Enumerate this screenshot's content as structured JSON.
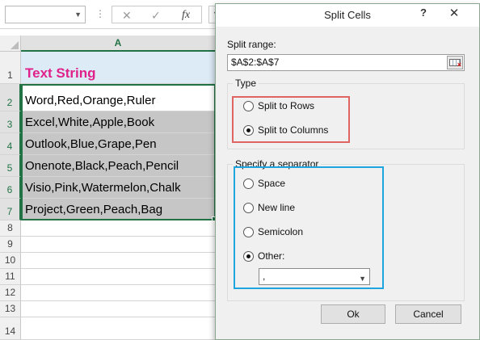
{
  "formula_bar": {
    "name_box_value": "",
    "cancel_icon": "✕",
    "enter_icon": "✓",
    "fx_label": "fx",
    "formula_value": ""
  },
  "sheet": {
    "columns": [
      "A"
    ],
    "rows": [
      {
        "num": "1",
        "value": "Text String"
      },
      {
        "num": "2",
        "value": "Word,Red,Orange,Ruler"
      },
      {
        "num": "3",
        "value": "Excel,White,Apple,Book"
      },
      {
        "num": "4",
        "value": "Outlook,Blue,Grape,Pen"
      },
      {
        "num": "5",
        "value": "Onenote,Black,Peach,Pencil"
      },
      {
        "num": "6",
        "value": "Visio,Pink,Watermelon,Chalk"
      },
      {
        "num": "7",
        "value": "Project,Green,Peach,Bag"
      },
      {
        "num": "8",
        "value": ""
      },
      {
        "num": "9",
        "value": ""
      },
      {
        "num": "10",
        "value": ""
      },
      {
        "num": "11",
        "value": ""
      },
      {
        "num": "12",
        "value": ""
      },
      {
        "num": "13",
        "value": ""
      },
      {
        "num": "14",
        "value": ""
      }
    ],
    "colors": {
      "header_fill": "#ddebf7",
      "title_text": "#e0218a",
      "selected_fill": "#c6c6c6",
      "selection_border": "#217346"
    }
  },
  "dialog": {
    "title": "Split Cells",
    "help_label": "?",
    "close_label": "✕",
    "split_range_label": "Split range:",
    "split_range_value": "$A$2:$A$7",
    "type_group": {
      "legend": "Type",
      "options": [
        {
          "label": "Split to Rows",
          "selected": false
        },
        {
          "label": "Split to Columns",
          "selected": true
        }
      ]
    },
    "separator_group": {
      "legend": "Specify a separator",
      "options": [
        {
          "label": "Space",
          "selected": false
        },
        {
          "label": "New line",
          "selected": false
        },
        {
          "label": "Semicolon",
          "selected": false
        },
        {
          "label": "Other:",
          "selected": true
        }
      ],
      "other_value": ","
    },
    "ok_label": "Ok",
    "cancel_label": "Cancel",
    "highlight_colors": {
      "type": "#e06463",
      "separator": "#1ea5e0"
    }
  }
}
